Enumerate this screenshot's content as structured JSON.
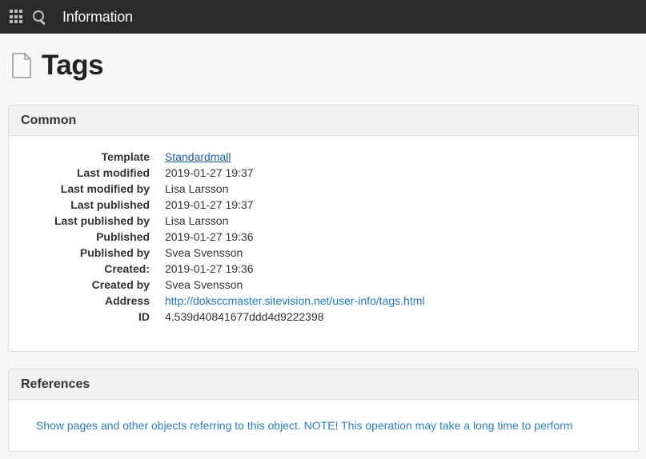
{
  "topbar": {
    "title": "Information",
    "icons": [
      "apps-grid-icon",
      "search-icon"
    ]
  },
  "page": {
    "title": "Tags",
    "icon": "document-icon"
  },
  "common": {
    "heading": "Common",
    "rows": [
      {
        "label": "Template",
        "value": "Standardmall"
      },
      {
        "label": "Last modified",
        "value": "2019-01-27 19:37"
      },
      {
        "label": "Last modified by",
        "value": "Lisa Larsson"
      },
      {
        "label": "Last published",
        "value": "2019-01-27 19:37"
      },
      {
        "label": "Last published by",
        "value": "Lisa Larsson"
      },
      {
        "label": "Published",
        "value": "2019-01-27 19:36"
      },
      {
        "label": "Published by",
        "value": "Svea Svensson"
      },
      {
        "label": "Created:",
        "value": "2019-01-27 19:36"
      },
      {
        "label": "Created by",
        "value": "Svea Svensson"
      },
      {
        "label": "Address",
        "value": "http://doksccmaster.sitevision.net/user-info/tags.html"
      },
      {
        "label": "ID",
        "value": "4.539d40841677ddd4d9222398"
      }
    ]
  },
  "references": {
    "heading": "References",
    "link": "Show pages and other objects referring to this object. NOTE! This operation may take a long time to perform"
  },
  "colors": {
    "topbar_bg": "#2a2a2a",
    "link": "#2a7ec6",
    "panel_header_bg": "#f2f2f2"
  }
}
